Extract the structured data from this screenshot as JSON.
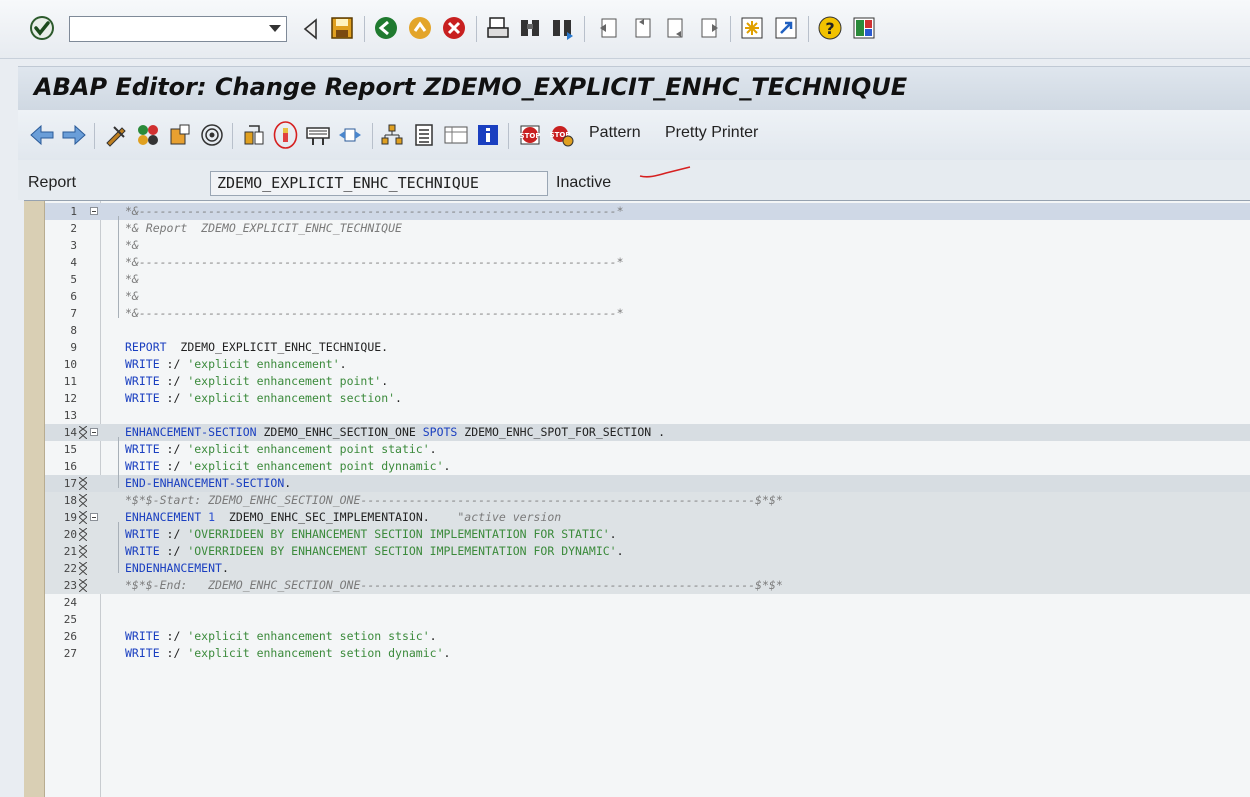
{
  "system_toolbar": {
    "command_field": {
      "value": "",
      "placeholder": ""
    },
    "buttons": [
      "enter-icon",
      "back-icon",
      "save-icon",
      "exit-icon",
      "log-off-icon",
      "cancel-icon",
      "print-icon",
      "find-icon",
      "find-next-icon",
      "first-page-icon",
      "previous-page-icon",
      "next-page-icon",
      "last-page-icon",
      "new-session-icon",
      "shortcut-icon",
      "help-icon",
      "layout-icon"
    ]
  },
  "window": {
    "title": "ABAP Editor: Change Report ZDEMO_EXPLICIT_ENHC_TECHNIQUE"
  },
  "app_toolbar": {
    "icons": [
      "back-arrow-icon",
      "forward-arrow-icon",
      "other-object-icon",
      "check-icon",
      "activate-icon",
      "test-icon",
      "where-used-icon",
      "enhance-icon",
      "display-change-icon",
      "insert-statement-icon",
      "move-icon",
      "object-list-icon",
      "hierarchy-icon",
      "display-object-list-icon",
      "info-icon",
      "breakpoint-set-icon",
      "breakpoint-session-icon"
    ],
    "pattern_label": "Pattern",
    "pretty_printer_label": "Pretty Printer"
  },
  "report_bar": {
    "label": "Report",
    "name": "ZDEMO_EXPLICIT_ENHC_TECHNIQUE",
    "status": "Inactive"
  },
  "colors": {
    "keyword": "#1a3fc0",
    "string": "#3b8a3b",
    "comment": "#7a7a7a",
    "gutter": "#d9cfb4",
    "annotation": "#d62020"
  },
  "editor": {
    "lines": [
      {
        "n": "1",
        "hl": "blue",
        "fold": true,
        "parts": [
          [
            "comment",
            "*&---------------------------------------------------------------------*"
          ]
        ]
      },
      {
        "n": "2",
        "parts": [
          [
            "comment",
            "*& Report  ZDEMO_EXPLICIT_ENHC_TECHNIQUE"
          ]
        ]
      },
      {
        "n": "3",
        "parts": [
          [
            "comment",
            "*&"
          ]
        ]
      },
      {
        "n": "4",
        "parts": [
          [
            "comment",
            "*&---------------------------------------------------------------------*"
          ]
        ]
      },
      {
        "n": "5",
        "parts": [
          [
            "comment",
            "*&"
          ]
        ]
      },
      {
        "n": "6",
        "parts": [
          [
            "comment",
            "*&"
          ]
        ]
      },
      {
        "n": "7",
        "parts": [
          [
            "comment",
            "*&---------------------------------------------------------------------*"
          ]
        ]
      },
      {
        "n": "8",
        "parts": []
      },
      {
        "n": "9",
        "parts": [
          [
            "key",
            "REPORT"
          ],
          [
            "plain",
            "  ZDEMO_EXPLICIT_ENHC_TECHNIQUE."
          ]
        ]
      },
      {
        "n": "10",
        "parts": [
          [
            "key",
            "WRITE"
          ],
          [
            "plain",
            " :/ "
          ],
          [
            "str",
            "'explicit enhancement'"
          ],
          [
            "plain",
            "."
          ]
        ]
      },
      {
        "n": "11",
        "parts": [
          [
            "key",
            "WRITE"
          ],
          [
            "plain",
            " :/ "
          ],
          [
            "str",
            "'explicit enhancement point'"
          ],
          [
            "plain",
            "."
          ]
        ]
      },
      {
        "n": "12",
        "parts": [
          [
            "key",
            "WRITE"
          ],
          [
            "plain",
            " :/ "
          ],
          [
            "str",
            "'explicit enhancement section'"
          ],
          [
            "plain",
            "."
          ]
        ]
      },
      {
        "n": "13",
        "parts": []
      },
      {
        "n": "14",
        "hl": "grey",
        "fold": true,
        "x": true,
        "parts": [
          [
            "key",
            "ENHANCEMENT-SECTION"
          ],
          [
            "plain",
            " ZDEMO_ENHC_SECTION_ONE "
          ],
          [
            "key",
            "SPOTS"
          ],
          [
            "plain",
            " ZDEMO_ENHC_SPOT_FOR_SECTION ."
          ]
        ]
      },
      {
        "n": "15",
        "parts": [
          [
            "key",
            "WRITE"
          ],
          [
            "plain",
            " :/ "
          ],
          [
            "str",
            "'explicit enhancement point static'"
          ],
          [
            "plain",
            "."
          ]
        ]
      },
      {
        "n": "16",
        "parts": [
          [
            "key",
            "WRITE"
          ],
          [
            "plain",
            " :/ "
          ],
          [
            "str",
            "'explicit enhancement point dynnamic'"
          ],
          [
            "plain",
            "."
          ]
        ]
      },
      {
        "n": "17",
        "hl": "grey",
        "x": true,
        "parts": [
          [
            "key",
            "END-ENHANCEMENT-SECTION"
          ],
          [
            "plain",
            "."
          ]
        ]
      },
      {
        "n": "18",
        "hl": "grey2",
        "x": true,
        "parts": [
          [
            "comment",
            "*$*$-Start: ZDEMO_ENHC_SECTION_ONE---------------------------------------------------------$*$*"
          ]
        ]
      },
      {
        "n": "19",
        "hl": "grey2",
        "fold": true,
        "x": true,
        "parts": [
          [
            "key",
            "ENHANCEMENT"
          ],
          [
            "plain",
            " "
          ],
          [
            "num",
            "1"
          ],
          [
            "plain",
            "  ZDEMO_ENHC_SEC_IMPLEMENTAION.    "
          ],
          [
            "comment",
            "\"active version"
          ]
        ]
      },
      {
        "n": "20",
        "hl": "grey2",
        "x": true,
        "parts": [
          [
            "key",
            "WRITE"
          ],
          [
            "plain",
            " :/ "
          ],
          [
            "str",
            "'OVERRIDEEN BY ENHANCEMENT SECTION IMPLEMENTATION FOR STATIC'"
          ],
          [
            "plain",
            "."
          ]
        ]
      },
      {
        "n": "21",
        "hl": "grey2",
        "x": true,
        "parts": [
          [
            "key",
            "WRITE"
          ],
          [
            "plain",
            " :/ "
          ],
          [
            "str",
            "'OVERRIDEEN BY ENHANCEMENT SECTION IMPLEMENTATION FOR DYNAMIC'"
          ],
          [
            "plain",
            "."
          ]
        ]
      },
      {
        "n": "22",
        "hl": "grey2",
        "x": true,
        "parts": [
          [
            "key",
            "ENDENHANCEMENT"
          ],
          [
            "plain",
            "."
          ]
        ]
      },
      {
        "n": "23",
        "hl": "grey2",
        "x": true,
        "parts": [
          [
            "comment",
            "*$*$-End:   ZDEMO_ENHC_SECTION_ONE---------------------------------------------------------$*$*"
          ]
        ]
      },
      {
        "n": "24",
        "parts": []
      },
      {
        "n": "25",
        "parts": []
      },
      {
        "n": "26",
        "parts": [
          [
            "key",
            "WRITE"
          ],
          [
            "plain",
            " :/ "
          ],
          [
            "str",
            "'explicit enhancement setion stsic'"
          ],
          [
            "plain",
            "."
          ]
        ]
      },
      {
        "n": "27",
        "parts": [
          [
            "key",
            "WRITE"
          ],
          [
            "plain",
            " :/ "
          ],
          [
            "str",
            "'explicit enhancement setion dynamic'"
          ],
          [
            "plain",
            "."
          ]
        ]
      }
    ]
  }
}
